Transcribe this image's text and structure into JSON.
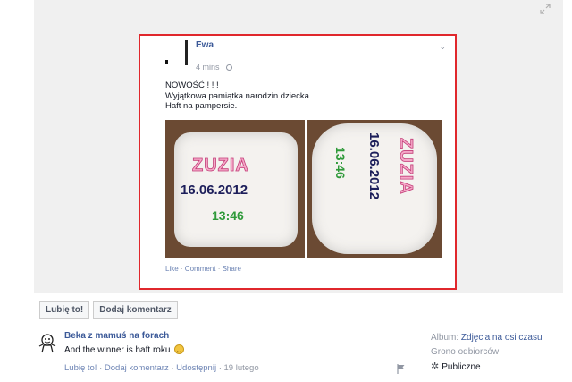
{
  "post": {
    "author": "Ewa",
    "time": "4 mins ·",
    "lines": [
      "NOWOŚĆ ! ! !",
      "Wyjątkowa pamiątka narodzin dziecka",
      "Haft na pampersie."
    ],
    "photos": [
      {
        "name": "ZUZIA",
        "date": "16.06.2012",
        "time": "13:46"
      },
      {
        "name": "ZUZIA",
        "date": "16.06.2012",
        "time": "13:46"
      }
    ],
    "actions": {
      "like": "Like",
      "sep1": " · ",
      "comment": "Comment",
      "sep2": " · ",
      "share": "Share"
    }
  },
  "buttons": {
    "like": "Lubię to!",
    "comment": "Dodaj komentarz"
  },
  "owner": {
    "name": "Beka z mamuś na forach",
    "caption": "And the winner is haft roku",
    "actions": {
      "like": "Lubię to!",
      "sep1": " · ",
      "comment": "Dodaj komentarz",
      "sep2": " · ",
      "share": "Udostępnij",
      "sep3": " · ",
      "date": "19 lutego"
    }
  },
  "sidebar": {
    "album_label": "Album:",
    "album_value": "Zdjęcia na osi czasu",
    "audience_label": "Grono odbiorców:",
    "audience_value": "Publiczne"
  },
  "icons": {
    "expand": "expand-icon",
    "globe": "globe-icon",
    "smile": "smile-emoticon-icon",
    "flag": "flag-icon",
    "gear": "gear-icon"
  },
  "colors": {
    "link": "#3b5998",
    "highlight_border": "#e0272c",
    "muted": "#9197a3"
  }
}
